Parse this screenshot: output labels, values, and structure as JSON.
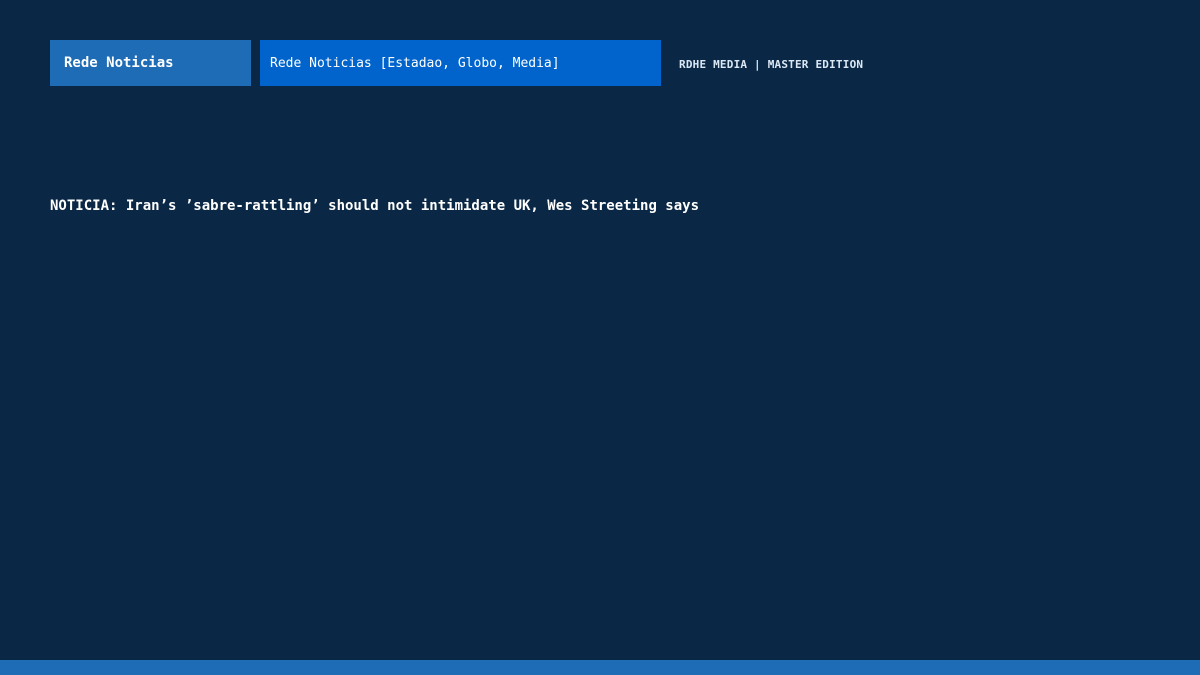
{
  "header": {
    "brand_tab": "Rede Noticias",
    "source_tab": "Rede Noticias [Estadao, Globo, Media]",
    "edition_label": "RDHE MEDIA | MASTER EDITION"
  },
  "main": {
    "headline": "NOTICIA: Iran’s ’sabre-rattling’ should not intimidate UK, Wes Streeting says"
  },
  "colors": {
    "background": "#0a2745",
    "brand_tab": "#1e6bb6",
    "source_tab": "#0064cc",
    "bottom_bar": "#1e6bb6"
  }
}
